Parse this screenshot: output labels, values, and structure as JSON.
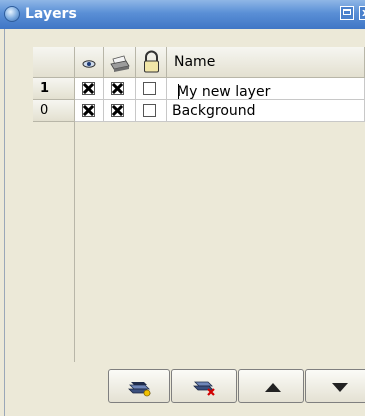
{
  "window": {
    "title": "Layers",
    "close_glyph": "x"
  },
  "table": {
    "columns": {
      "visible_icon": "eye-icon",
      "print_icon": "printer-icon",
      "lock_icon": "padlock-icon",
      "name": "Name"
    },
    "rows": [
      {
        "index": "1",
        "visible": true,
        "printable": true,
        "locked": false,
        "name": "My new layer",
        "editing": true,
        "current": true
      },
      {
        "index": "0",
        "visible": true,
        "printable": true,
        "locked": false,
        "name": "Background",
        "editing": false,
        "current": false
      }
    ]
  },
  "toolbar": {
    "buttons": [
      "add-layer-icon",
      "delete-layer-icon",
      "move-up-icon",
      "move-down-icon"
    ]
  }
}
